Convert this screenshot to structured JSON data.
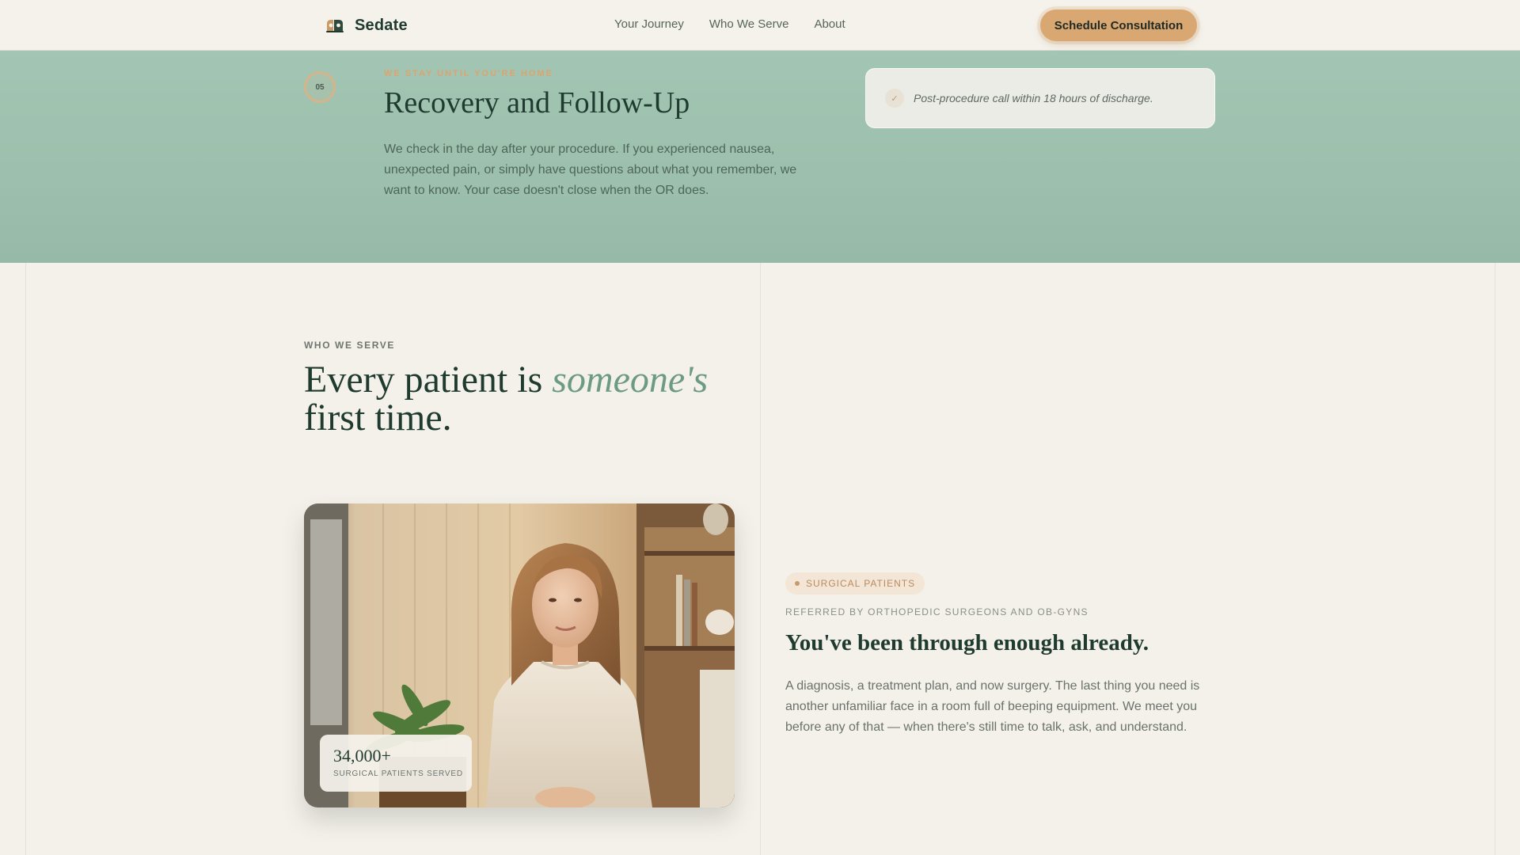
{
  "nav": {
    "brand": "Sedate",
    "links": [
      "Your Journey",
      "Who We Serve",
      "About"
    ],
    "cta": "Schedule Consultation"
  },
  "recovery": {
    "step_number": "05",
    "eyebrow": "WE STAY UNTIL YOU'RE HOME",
    "title": "Recovery and Follow-Up",
    "description": "We check in the day after your procedure. If you experienced nausea, unexpected pain, or simply have questions about what you remember, we want to know. Your case doesn't close when the OR does.",
    "note": "Post-procedure call within 18 hours of discharge."
  },
  "serve": {
    "eyebrow": "WHO WE SERVE",
    "headline_before": "Every patient is ",
    "headline_emphasis": "someone's",
    "headline_after": "first time.",
    "stat_value": "34,000+",
    "stat_label": "SURGICAL PATIENTS SERVED",
    "pill": "SURGICAL PATIENTS",
    "referral": "REFERRED BY ORTHOPEDIC SURGEONS AND OB-GYNS",
    "audience_title": "You've been through enough already.",
    "audience_description": "A diagnosis, a treatment plan, and now surgery. The last thing you need is another unfamiliar face in a room full of beeping equipment. We meet you before any of that — when there's still time to talk, ask, and understand."
  },
  "colors": {
    "accent": "#d9a772",
    "brand_green": "#1f3b2f",
    "band_green": "#9cc0ad",
    "emphasis_green": "#6d9a82",
    "background": "#f4f1ea"
  }
}
